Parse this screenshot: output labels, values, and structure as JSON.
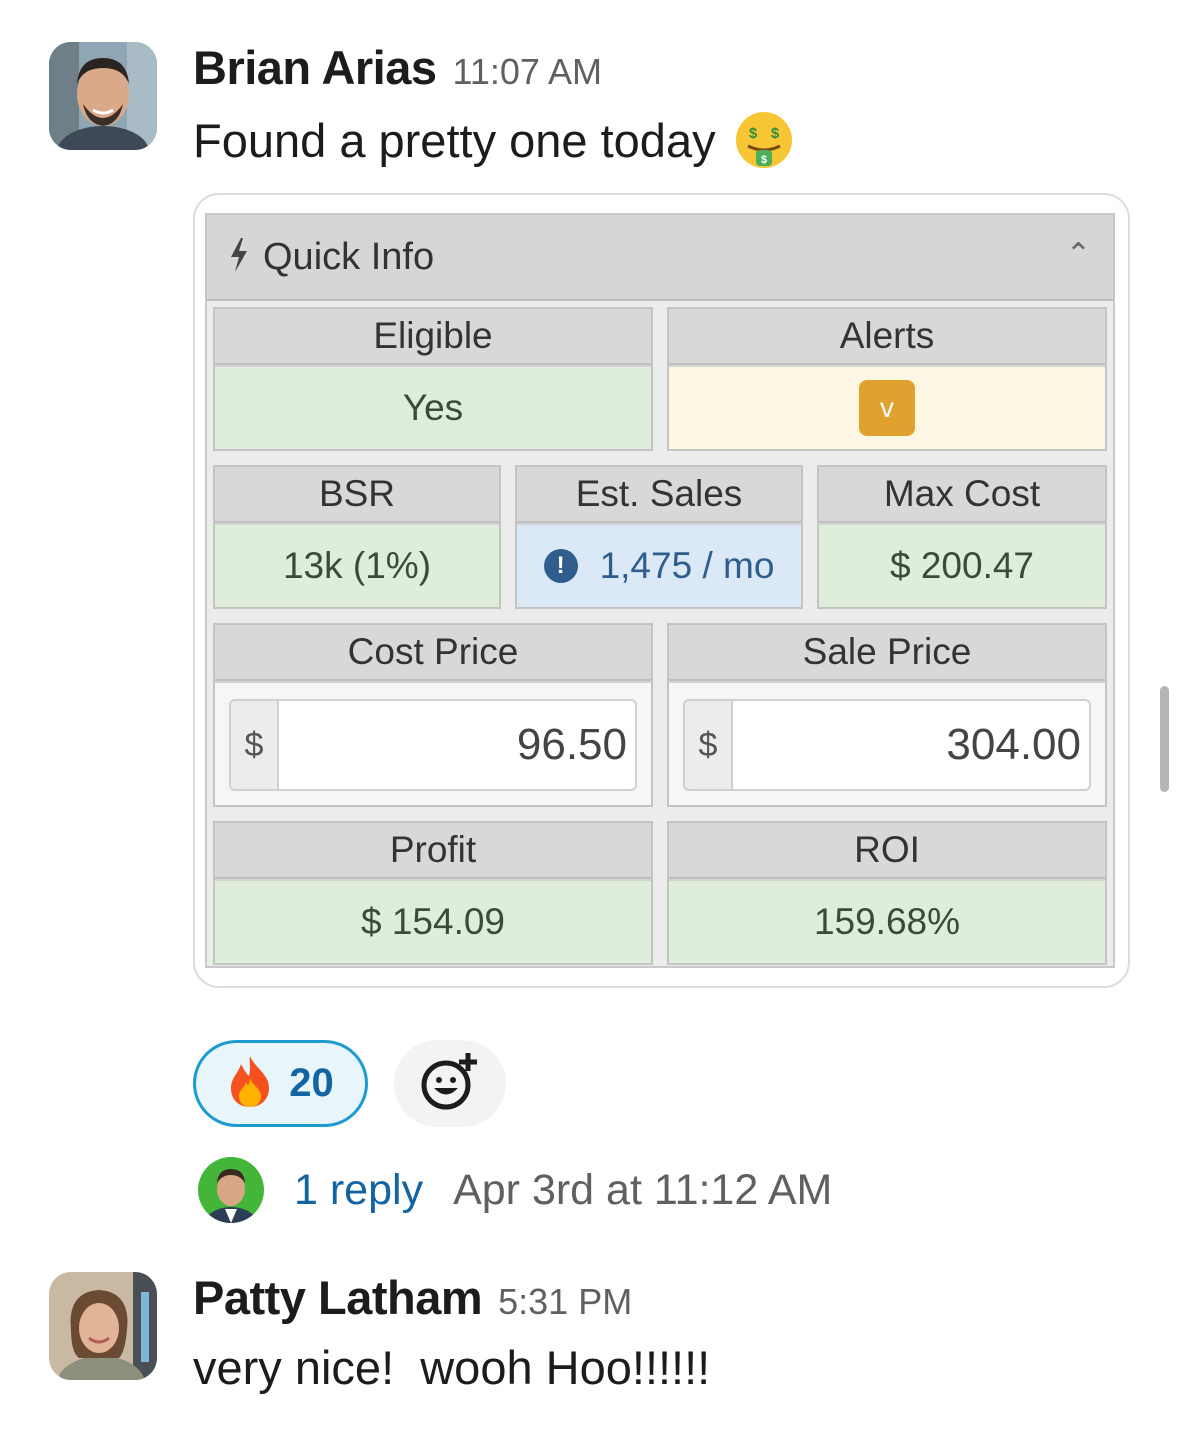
{
  "messages": [
    {
      "author": "Brian Arias",
      "time": "11:07 AM",
      "text": "Found a pretty one today",
      "emoji": "money-mouth-face"
    },
    {
      "author": "Patty Latham",
      "time": "5:31 PM",
      "text": "very nice!  wooh Hoo!!!!!!"
    }
  ],
  "quick_info": {
    "title": "Quick Info",
    "eligible": {
      "label": "Eligible",
      "value": "Yes"
    },
    "alerts": {
      "label": "Alerts",
      "badge": "v"
    },
    "bsr": {
      "label": "BSR",
      "value": "13k (1%)"
    },
    "est_sales": {
      "label": "Est. Sales",
      "value": "1,475 / mo"
    },
    "max_cost": {
      "label": "Max Cost",
      "value": "$ 200.47"
    },
    "cost_price": {
      "label": "Cost Price",
      "currency": "$",
      "value": "96.50"
    },
    "sale_price": {
      "label": "Sale Price",
      "currency": "$",
      "value": "304.00"
    },
    "profit": {
      "label": "Profit",
      "value": "$ 154.09"
    },
    "roi": {
      "label": "ROI",
      "value": "159.68%"
    }
  },
  "reactions": [
    {
      "emoji": "fire",
      "count": "20"
    }
  ],
  "thread": {
    "reply_count": "1 reply",
    "last_reply": "Apr 3rd at 11:12 AM"
  },
  "colors": {
    "link": "#1264a3",
    "reaction_border": "#1d9bd1",
    "green_cell": "#dfeeda",
    "alert_badge": "#e0a12f"
  }
}
